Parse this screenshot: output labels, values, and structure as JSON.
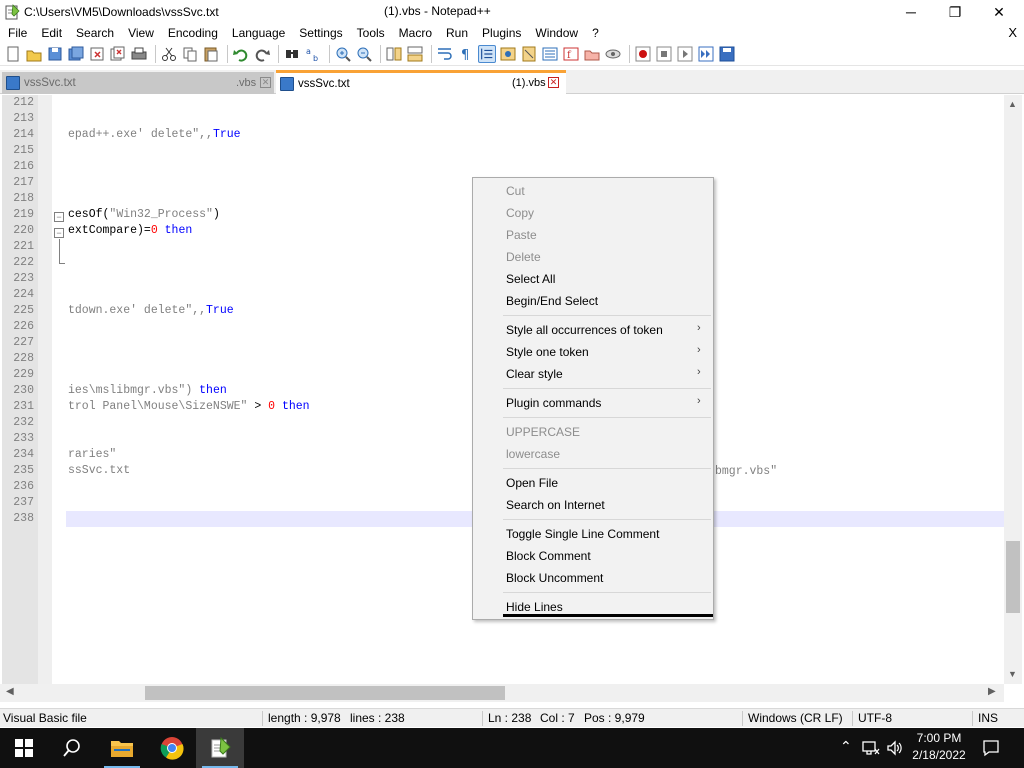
{
  "window": {
    "path": "C:\\Users\\VM5\\Downloads\\vssSvc.txt",
    "title": "(1).vbs - Notepad++",
    "min_glyph": "─",
    "max_glyph": "❐",
    "close_glyph": "✕"
  },
  "menu": {
    "items": [
      "File",
      "Edit",
      "Search",
      "View",
      "Encoding",
      "Language",
      "Settings",
      "Tools",
      "Macro",
      "Run",
      "Plugins",
      "Window",
      "?"
    ],
    "close_doc": "X"
  },
  "tabs": [
    {
      "name": "vssSvc.txt",
      "suffix": ".vbs",
      "close": "✕"
    },
    {
      "name": "vssSvc.txt",
      "suffix": "(1).vbs",
      "close": "✕"
    }
  ],
  "editor": {
    "lines": [
      {
        "num": "212",
        "segments": []
      },
      {
        "num": "213",
        "segments": []
      },
      {
        "num": "214",
        "segments": [
          {
            "t": "epad++.exe' delete\",,",
            "c": "str"
          },
          {
            "t": "True",
            "c": "kw"
          }
        ]
      },
      {
        "num": "215",
        "segments": []
      },
      {
        "num": "216",
        "segments": []
      },
      {
        "num": "217",
        "segments": []
      },
      {
        "num": "218",
        "segments": []
      },
      {
        "num": "219",
        "segments": [
          {
            "t": "cesOf(",
            "c": ""
          },
          {
            "t": "\"Win32_Process\"",
            "c": "str"
          },
          {
            "t": ")",
            "c": ""
          }
        ]
      },
      {
        "num": "220",
        "segments": [
          {
            "t": "extCompare)=",
            "c": ""
          },
          {
            "t": "0",
            "c": "num"
          },
          {
            "t": " then",
            "c": "kw"
          }
        ]
      },
      {
        "num": "221",
        "segments": []
      },
      {
        "num": "222",
        "segments": []
      },
      {
        "num": "223",
        "segments": []
      },
      {
        "num": "224",
        "segments": []
      },
      {
        "num": "225",
        "segments": [
          {
            "t": "tdown.exe' delete\",,",
            "c": "str"
          },
          {
            "t": "True",
            "c": "kw"
          }
        ]
      },
      {
        "num": "226",
        "segments": []
      },
      {
        "num": "227",
        "segments": []
      },
      {
        "num": "228",
        "segments": []
      },
      {
        "num": "229",
        "segments": []
      },
      {
        "num": "230",
        "segments": [
          {
            "t": "ies\\mslibmgr.vbs\")",
            "c": "str"
          },
          {
            "t": " then",
            "c": "kw"
          }
        ]
      },
      {
        "num": "231",
        "segments": [
          {
            "t": "trol Panel\\Mouse\\SizeNSWE\"",
            "c": "str"
          },
          {
            "t": " > ",
            "c": ""
          },
          {
            "t": "0",
            "c": "num"
          },
          {
            "t": " then",
            "c": "kw"
          }
        ]
      },
      {
        "num": "232",
        "segments": []
      },
      {
        "num": "233",
        "segments": []
      },
      {
        "num": "234",
        "segments": [
          {
            "t": "raries\"",
            "c": "str"
          }
        ]
      },
      {
        "num": "235",
        "segments": [
          {
            "t": "ssSvc.txt",
            "c": "str"
          }
        ]
      },
      {
        "num": "236",
        "segments": []
      },
      {
        "num": "237",
        "segments": []
      },
      {
        "num": "238",
        "segments": []
      }
    ],
    "right_fragment": "bmgr.vbs\""
  },
  "context_menu": {
    "items": [
      {
        "label": "Cut",
        "disabled": true,
        "submenu": false
      },
      {
        "label": "Copy",
        "disabled": true,
        "submenu": false
      },
      {
        "label": "Paste",
        "disabled": true,
        "submenu": false
      },
      {
        "label": "Delete",
        "disabled": true,
        "submenu": false
      },
      {
        "label": "Select All",
        "disabled": false,
        "submenu": false
      },
      {
        "label": "Begin/End Select",
        "disabled": false,
        "submenu": false
      },
      {
        "sep": true
      },
      {
        "label": "Style all occurrences of token",
        "disabled": false,
        "submenu": true
      },
      {
        "label": "Style one token",
        "disabled": false,
        "submenu": true
      },
      {
        "label": "Clear style",
        "disabled": false,
        "submenu": true
      },
      {
        "sep": true
      },
      {
        "label": "Plugin commands",
        "disabled": false,
        "submenu": true
      },
      {
        "sep": true
      },
      {
        "label": "UPPERCASE",
        "disabled": true,
        "submenu": false
      },
      {
        "label": "lowercase",
        "disabled": true,
        "submenu": false
      },
      {
        "sep": true
      },
      {
        "label": "Open File",
        "disabled": false,
        "submenu": false
      },
      {
        "label": "Search on Internet",
        "disabled": false,
        "submenu": false
      },
      {
        "sep": true
      },
      {
        "label": "Toggle Single Line Comment",
        "disabled": false,
        "submenu": false
      },
      {
        "label": "Block Comment",
        "disabled": false,
        "submenu": false
      },
      {
        "label": "Block Uncomment",
        "disabled": false,
        "submenu": false
      },
      {
        "sep": true
      },
      {
        "label": "Hide Lines",
        "disabled": false,
        "submenu": false
      }
    ]
  },
  "status": {
    "filetype": "Visual Basic file",
    "length": "length : 9,978",
    "lines": "lines : 238",
    "ln": "Ln : 238",
    "col": "Col : 7",
    "pos": "Pos : 9,979",
    "eol": "Windows (CR LF)",
    "encoding": "UTF-8",
    "mode": "INS"
  },
  "taskbar": {
    "time": "7:00 PM",
    "date": "2/18/2022"
  },
  "colors": {
    "tab_accent": "#f9a235",
    "keyword": "#0000ff",
    "string": "#808080",
    "number": "#ff0000",
    "current_line": "#e8e8ff"
  }
}
